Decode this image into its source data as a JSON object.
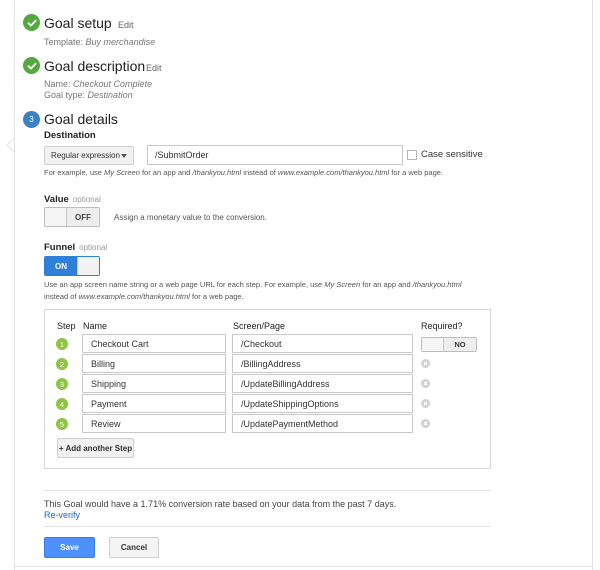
{
  "steps": [
    {
      "title": "Goal setup",
      "edit": "Edit",
      "sub1_label": "Template:",
      "sub1_value": "Buy merchandise"
    },
    {
      "title": "Goal description",
      "edit": "Edit",
      "sub1_label": "Name:",
      "sub1_value": "Checkout Complete",
      "sub2_label": "Goal type:",
      "sub2_value": "Destination"
    },
    {
      "number": "3",
      "title": "Goal details"
    }
  ],
  "destination": {
    "label": "Destination",
    "match_type": "Regular expression",
    "value": "/SubmitOrder",
    "case_sensitive_label": "Case sensitive",
    "case_sensitive_checked": false,
    "help": {
      "p1": "For example, use ",
      "e1": "My Screen",
      "p2": " for an app and ",
      "e2": "/thankyou.html",
      "p3": " instead of ",
      "e3": "www.example.com/thankyou.html",
      "p4": " for a web page."
    }
  },
  "value_section": {
    "label": "Value",
    "optional": "optional",
    "toggle": "OFF",
    "description": "Assign a monetary value to the conversion."
  },
  "funnel": {
    "label": "Funnel",
    "optional": "optional",
    "toggle": "ON",
    "help_line1": {
      "p1": "Use an app screen name string or a web page URL for each step. For example, use ",
      "e1": "My Screen",
      "p2": " for an app and ",
      "e2": "/thankyou.html"
    },
    "help_line2": {
      "p1": "instead of ",
      "e1": "www.example.com/thankyou.html",
      "p2": " for a web page."
    },
    "headers": {
      "step": "Step",
      "name": "Name",
      "screen": "Screen/Page",
      "required": "Required?"
    },
    "required_toggle": "NO",
    "rows": [
      {
        "num": "1",
        "name": "Checkout Cart",
        "screen": "/Checkout"
      },
      {
        "num": "2",
        "name": "Billing",
        "screen": "/BillingAddress"
      },
      {
        "num": "3",
        "name": "Shipping",
        "screen": "/UpdateBillingAddress"
      },
      {
        "num": "4",
        "name": "Payment",
        "screen": "/UpdateShippingOptions"
      },
      {
        "num": "5",
        "name": "Review",
        "screen": "/UpdatePaymentMethod"
      }
    ],
    "add_step": "+ Add another Step"
  },
  "summary": {
    "text": "This Goal would have a 1.71% conversion rate based on your data from the past 7 days.",
    "reverify": "Re-verify"
  },
  "buttons": {
    "save": "Save",
    "cancel": "Cancel"
  },
  "colors": {
    "done": "#53a93f",
    "active": "#3b82c4",
    "funnel_step": "#8cc63f",
    "primary": "#4d90fe",
    "link": "#1a66c9"
  }
}
